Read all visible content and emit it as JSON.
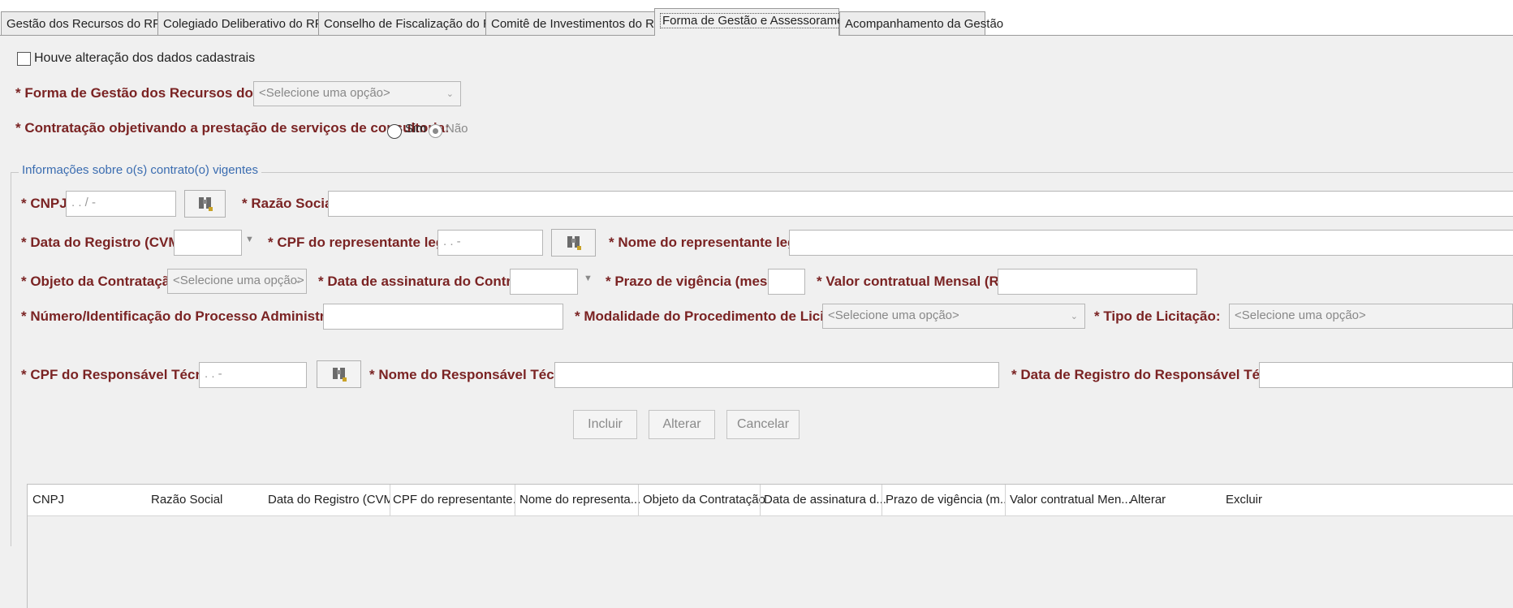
{
  "tabs": [
    {
      "label": "Gestão dos Recursos do RPPS"
    },
    {
      "label": "Colegiado Deliberativo do RPPS"
    },
    {
      "label": "Conselho de Fiscalização do RPPS"
    },
    {
      "label": "Comitê de Investimentos do RPPS"
    },
    {
      "label": "Forma de Gestão e Assessoramento",
      "active": true
    },
    {
      "label": "Acompanhamento da Gestão"
    }
  ],
  "form": {
    "change_checkbox_label": "Houve alteração dos dados cadastrais",
    "forma_gestao_label": "* Forma de Gestão dos Recursos do RPPS:",
    "forma_gestao_value": "<Selecione uma opção>",
    "consultoria_label": "* Contratação objetivando a prestação de serviços de consultoria:",
    "radio_sim": "Sim",
    "radio_nao": "Não",
    "radio_selected": "Não"
  },
  "contracts": {
    "group_title": "Informações sobre o(s) contrato(o) vigentes",
    "cnpj_label": "* CNPJ:",
    "cnpj_mask": ". . / -",
    "razao_label": "* Razão Social:",
    "data_registro_label": "* Data do Registro (CVM):",
    "cpf_rep_label": "* CPF do representante legal:",
    "cpf_rep_mask": ". . -",
    "nome_rep_label": "* Nome do representante legal:",
    "objeto_label": "* Objeto da Contratação:",
    "objeto_value": "<Selecione uma opção>",
    "data_assinatura_label": "* Data de assinatura do Contrato:",
    "prazo_label": "* Prazo de vigência (meses):",
    "valor_label": "* Valor contratual Mensal (R$):",
    "numero_label": "* Número/Identificação do Processo Administrativo:",
    "modalidade_label": "* Modalidade do Procedimento de Licitação:",
    "modalidade_value": "<Selecione uma opção>",
    "tipo_label": "* Tipo de Licitação:",
    "tipo_value": "<Selecione uma opção>",
    "cpf_resp_label": "* CPF do Responsável Técnico:",
    "cpf_resp_mask": ". . -",
    "nome_resp_label": "* Nome do Responsável Técnico:",
    "data_resp_label": "* Data de Registro do Responsável Técnico:"
  },
  "buttons": {
    "incluir": "Incluir",
    "alterar": "Alterar",
    "cancelar": "Cancelar"
  },
  "table": {
    "columns": [
      "CNPJ",
      "Razão Social",
      "Data do Registro (CVM)",
      "CPF do representante...",
      "Nome do representa...",
      "Objeto da Contratação",
      "Data de assinatura d...",
      "Prazo de vigência (m...",
      "Valor contratual Men...",
      "Alterar",
      "Excluir"
    ],
    "rows": []
  }
}
